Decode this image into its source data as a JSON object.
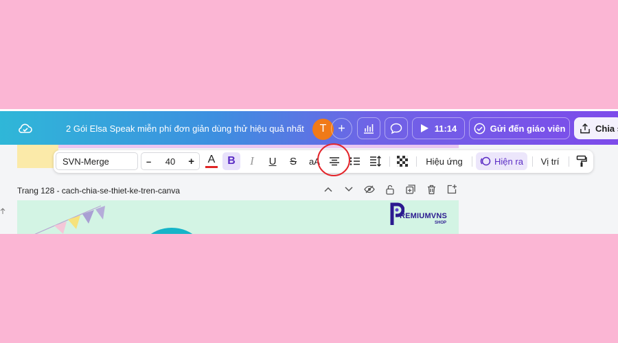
{
  "header": {
    "document_title": "2 Gói Elsa Speak miễn phí đơn giản dùng thử hiệu quả nhất",
    "avatar_initial": "T",
    "timer": "11:14",
    "send_button_label": "Gửi đến giáo viên",
    "share_button_label": "Chia s",
    "icons": [
      "cloud-sync-icon",
      "add-icon",
      "insights-icon",
      "comment-icon",
      "play-icon",
      "check-circle-icon",
      "share-upload-icon"
    ]
  },
  "text_toolbar": {
    "font_family": "SVN-Merge",
    "font_size": "40",
    "decrease_label": "–",
    "increase_label": "+",
    "text_color": "#e02424",
    "case_label": "aA",
    "effects_label": "Hiệu ứng",
    "animate_label": "Hiện ra",
    "position_label": "Vị trí",
    "icons": [
      "text-color-icon",
      "bold-icon",
      "italic-icon",
      "underline-icon",
      "strikethrough-icon",
      "align-center-icon",
      "list-icon",
      "line-spacing-icon",
      "transparency-icon",
      "animate-icon",
      "paint-format-icon"
    ]
  },
  "page": {
    "label": "Trang 128 - cach-chia-se-thiet-ke-tren-canva",
    "icons": [
      "chevron-up-icon",
      "chevron-down-icon",
      "hide-page-icon",
      "lock-icon",
      "duplicate-icon",
      "delete-icon",
      "add-page-icon"
    ]
  },
  "canvas": {
    "logo_text_main": "REMIUMVNS",
    "logo_text_sub": "SHOP"
  },
  "colors": {
    "background": "#fbb6d4",
    "header_gradient_start": "#2fb7d8",
    "header_gradient_end": "#7d4bea",
    "accent_purple": "#7d2ae8",
    "highlight_circle": "#e3252b",
    "canvas_bg": "#d3f4e4"
  }
}
